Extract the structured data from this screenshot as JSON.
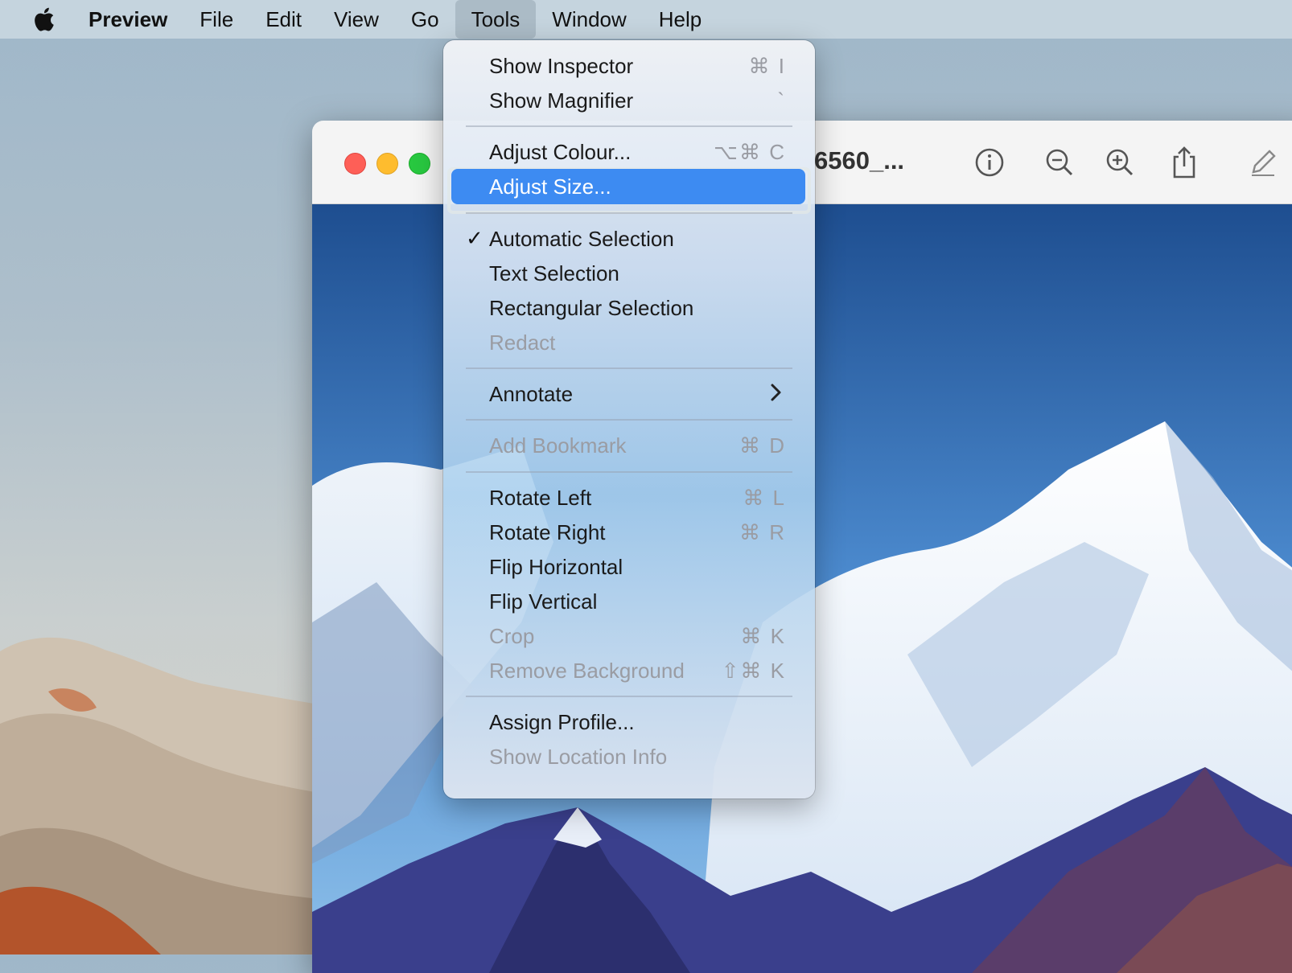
{
  "menubar": {
    "app": "Preview",
    "items": [
      "File",
      "Edit",
      "View",
      "Go",
      "Tools",
      "Window",
      "Help"
    ]
  },
  "window": {
    "title": "6560_..."
  },
  "tools_menu": {
    "show_inspector": {
      "label": "Show Inspector",
      "shortcut": "⌘ I"
    },
    "show_magnifier": {
      "label": "Show Magnifier",
      "shortcut": "`"
    },
    "adjust_colour": {
      "label": "Adjust Colour...",
      "shortcut": "⌥⌘ C"
    },
    "adjust_size": {
      "label": "Adjust Size..."
    },
    "automatic_selection": {
      "label": "Automatic Selection",
      "check": "✓"
    },
    "text_selection": {
      "label": "Text Selection"
    },
    "rectangular_selection": {
      "label": "Rectangular Selection"
    },
    "redact": {
      "label": "Redact"
    },
    "annotate": {
      "label": "Annotate"
    },
    "add_bookmark": {
      "label": "Add Bookmark",
      "shortcut": "⌘ D"
    },
    "rotate_left": {
      "label": "Rotate Left",
      "shortcut": "⌘ L"
    },
    "rotate_right": {
      "label": "Rotate Right",
      "shortcut": "⌘ R"
    },
    "flip_horizontal": {
      "label": "Flip Horizontal"
    },
    "flip_vertical": {
      "label": "Flip Vertical"
    },
    "crop": {
      "label": "Crop",
      "shortcut": "⌘ K"
    },
    "remove_background": {
      "label": "Remove Background",
      "shortcut": "⇧⌘ K"
    },
    "assign_profile": {
      "label": "Assign Profile..."
    },
    "show_location_info": {
      "label": "Show Location Info"
    }
  },
  "colors": {
    "highlight": "#3d8bf2",
    "callout": "#f4d53b"
  }
}
